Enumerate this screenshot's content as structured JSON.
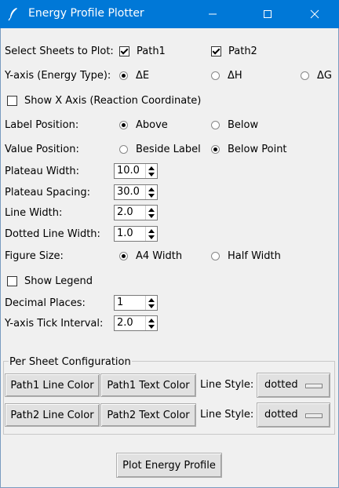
{
  "window": {
    "title": "Energy Profile Plotter",
    "icon": "feather-icon"
  },
  "sheets": {
    "label": "Select Sheets to Plot:",
    "options": [
      {
        "label": "Path1",
        "checked": true
      },
      {
        "label": "Path2",
        "checked": true
      }
    ]
  },
  "y_axis": {
    "label": "Y-axis (Energy Type):",
    "options": [
      {
        "label": "ΔE",
        "selected": true
      },
      {
        "label": "ΔH",
        "selected": false
      },
      {
        "label": "ΔG",
        "selected": false
      }
    ]
  },
  "show_x_axis": {
    "label": "Show X Axis (Reaction Coordinate)",
    "checked": false
  },
  "label_position": {
    "label": "Label Position:",
    "options": [
      {
        "label": "Above",
        "selected": true
      },
      {
        "label": "Below",
        "selected": false
      }
    ]
  },
  "value_position": {
    "label": "Value Position:",
    "options": [
      {
        "label": "Beside Label",
        "selected": false
      },
      {
        "label": "Below Point",
        "selected": true
      }
    ]
  },
  "plateau_width": {
    "label": "Plateau Width:",
    "value": "10.0"
  },
  "plateau_spacing": {
    "label": "Plateau Spacing:",
    "value": "30.0"
  },
  "line_width": {
    "label": "Line Width:",
    "value": "2.0"
  },
  "dotted_line_width": {
    "label": "Dotted Line Width:",
    "value": "1.0"
  },
  "figure_size": {
    "label": "Figure Size:",
    "options": [
      {
        "label": "A4 Width",
        "selected": true
      },
      {
        "label": "Half Width",
        "selected": false
      }
    ]
  },
  "show_legend": {
    "label": "Show Legend",
    "checked": false
  },
  "decimal_places": {
    "label": "Decimal Places:",
    "value": "1"
  },
  "y_tick_interval": {
    "label": "Y-axis Tick Interval:",
    "value": "2.0"
  },
  "per_sheet": {
    "title": "Per Sheet Configuration",
    "rows": [
      {
        "line_color_label": "Path1 Line Color",
        "text_color_label": "Path1 Text Color",
        "style_label": "Line Style:",
        "style_value": "dotted"
      },
      {
        "line_color_label": "Path2 Line Color",
        "text_color_label": "Path2 Text Color",
        "style_label": "Line Style:",
        "style_value": "dotted"
      }
    ]
  },
  "plot_button": {
    "label": "Plot Energy Profile"
  },
  "colors": {
    "titlebar": "#0078d7",
    "window_bg": "#f0f0f0",
    "button_bg": "#e1e1e1"
  }
}
